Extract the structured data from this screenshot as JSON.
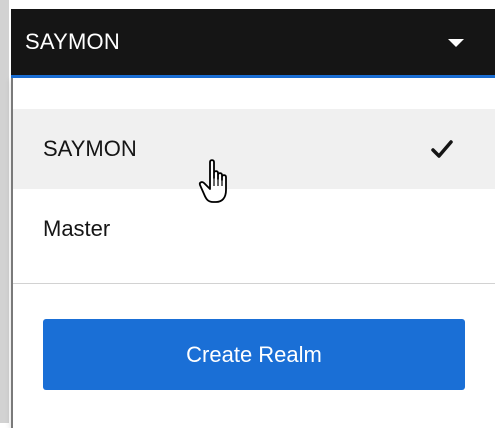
{
  "realm_selector": {
    "current": "SAYMON"
  },
  "menu": {
    "items": [
      {
        "label": "SAYMON",
        "selected": true
      },
      {
        "label": "Master",
        "selected": false
      }
    ]
  },
  "actions": {
    "create_realm": "Create Realm"
  },
  "icons": {
    "caret": "caret-down-icon",
    "check": "check-icon",
    "cursor": "hand-pointer-cursor-icon"
  },
  "colors": {
    "toggle_bg": "#151515",
    "accent": "#1a6fd6",
    "selected_bg": "#f0f0f0"
  }
}
